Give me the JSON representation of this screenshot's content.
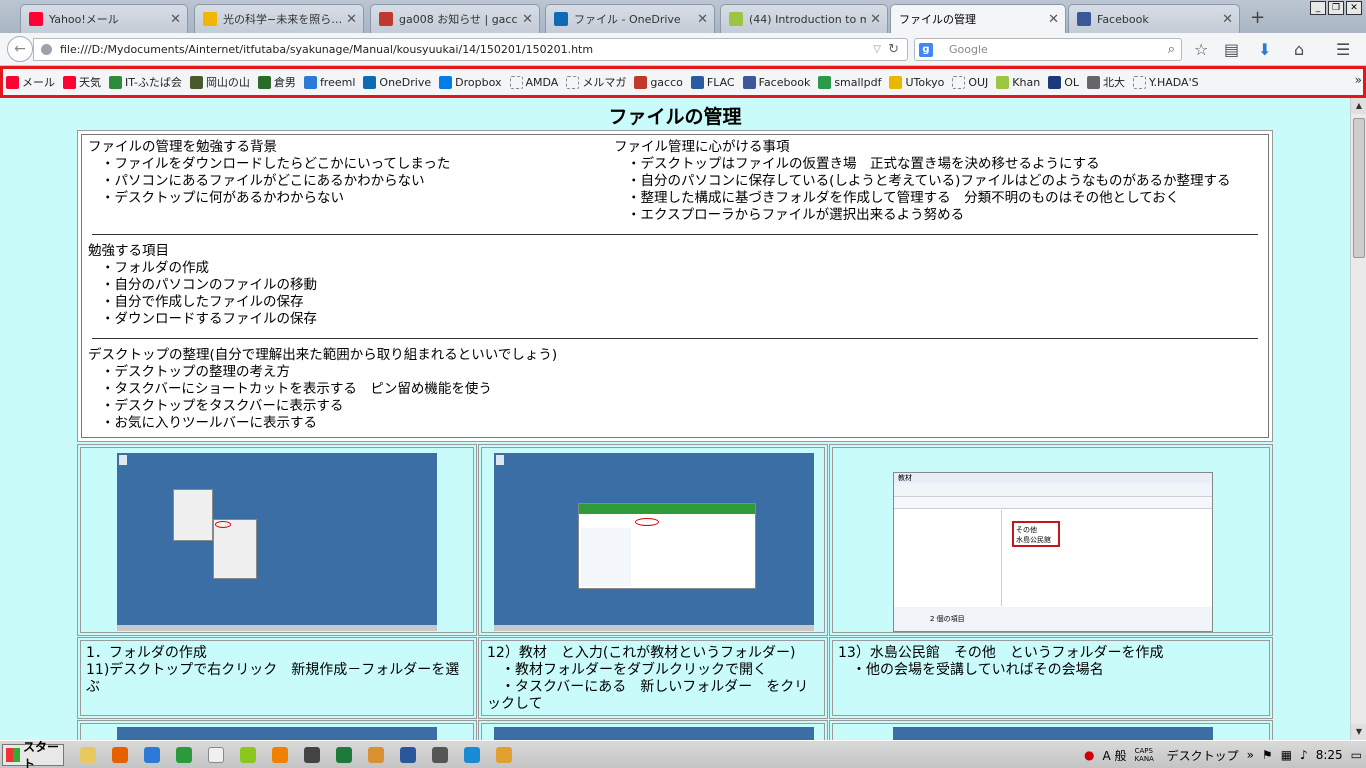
{
  "browser": {
    "tabs": [
      {
        "label": "Yahoo!メール",
        "icon": "yahoo-icon",
        "color": "#ff0033",
        "active": false
      },
      {
        "label": "光の科学−未来を照ら…",
        "icon": "gacco-leaf-icon",
        "color": "#f2b600",
        "active": false
      },
      {
        "label": "ga008 お知らせ | gacco",
        "icon": "gacco-icon",
        "color": "#c0392b",
        "active": false
      },
      {
        "label": "ファイル - OneDrive",
        "icon": "onedrive-icon",
        "color": "#0f6ab4",
        "active": false
      },
      {
        "label": "(44) Introduction to m…",
        "icon": "khan-icon",
        "color": "#9cc541",
        "active": false
      },
      {
        "label": "ファイルの管理",
        "icon": "page-icon",
        "color": "#ffffff",
        "active": true
      },
      {
        "label": "Facebook",
        "icon": "facebook-icon",
        "color": "#3b5998",
        "active": false
      }
    ],
    "url": "file:///D:/Mydocuments/Ainternet/itfutaba/syakunage/Manual/kousyuukai/14/150201/150201.htm",
    "search_placeholder": "Google",
    "bookmarks": [
      {
        "label": "メール",
        "color": "#ff0033"
      },
      {
        "label": "天気",
        "color": "#ff0033"
      },
      {
        "label": "IT-ふたば会",
        "color": "#2f8a3c"
      },
      {
        "label": "岡山の山",
        "color": "#4a5a2a"
      },
      {
        "label": "倉男",
        "color": "#2a6a2a"
      },
      {
        "label": "freeml",
        "color": "#2a7ad6"
      },
      {
        "label": "OneDrive",
        "color": "#0f6ab4"
      },
      {
        "label": "Dropbox",
        "color": "#007ee5"
      },
      {
        "label": "AMDA",
        "color": ""
      },
      {
        "label": "メルマガ",
        "color": ""
      },
      {
        "label": "gacco",
        "color": "#c0392b"
      },
      {
        "label": "FLAC",
        "color": "#2a5aa0"
      },
      {
        "label": "Facebook",
        "color": "#3b5998"
      },
      {
        "label": "smallpdf",
        "color": "#2a9a4a"
      },
      {
        "label": "UTokyo",
        "color": "#e8b800"
      },
      {
        "label": "OUJ",
        "color": ""
      },
      {
        "label": "Khan",
        "color": "#9cc541"
      },
      {
        "label": "OL",
        "color": "#1a3a7a"
      },
      {
        "label": "北大",
        "color": "#666666"
      },
      {
        "label": "Y.HADA'S",
        "color": ""
      }
    ],
    "bookmark_more": "»"
  },
  "page": {
    "title": "ファイルの管理",
    "background_heading": "ファイルの管理を勉強する背景",
    "background_items": [
      "・ファイルをダウンロードしたらどこかにいってしまった",
      "・パソコンにあるファイルがどこにあるかわからない",
      "・デスクトップに何があるかわからない"
    ],
    "tips_heading": "ファイル管理に心がける事項",
    "tips_items": [
      "・デスクトップはファイルの仮置き場　正式な置き場を決め移せるようにする",
      "・自分のパソコンに保存している(しようと考えている)ファイルはどのようなものがあるか整理する",
      "・整理した構成に基づきフォルダを作成して管理する　分類不明のものはその他としておく",
      "・エクスプローラからファイルが選択出来るよう努める"
    ],
    "study_heading": "勉強する項目",
    "study_items": [
      "・フォルダの作成",
      "・自分のパソコンのファイルの移動",
      "・自分で作成したファイルの保存",
      "・ダウンロードするファイルの保存"
    ],
    "desktop_heading": "デスクトップの整理(自分で理解出来た範囲から取り組まれるといいでしょう)",
    "desktop_items": [
      "・デスクトップの整理の考え方",
      "・タスクバーにショートカットを表示する　ピン留め機能を使う",
      "・デスクトップをタスクバーに表示する",
      "・お気に入りツールバーに表示する"
    ],
    "captions": [
      {
        "line1": "1．フォルダの作成",
        "line2": "11)デスクトップで右クリック　新規作成－フォルダーを選ぶ"
      },
      {
        "line1": "12）教材　と入力(これが教材というフォルダー)",
        "line2": "　・教材フォルダーをダブルクリックで開く",
        "line3": "　・タスクバーにある　新しいフォルダー　をクリックして"
      },
      {
        "line1": "13）水島公民館　その他　というフォルダーを作成",
        "line2": "　・他の会場を受講していればその会場名"
      }
    ],
    "explorer": {
      "title": "教材",
      "folders": [
        "その他",
        "水島公民館"
      ],
      "status": "2 個の項目"
    }
  },
  "taskbar": {
    "start_label": "スタート",
    "tray_ime": "A 般",
    "tray_caps": "CAPS KANA",
    "tray_desktop": "デスクトップ",
    "clock": "8:25"
  }
}
